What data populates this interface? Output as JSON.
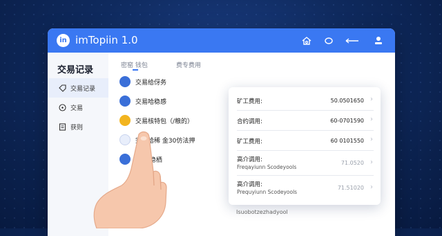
{
  "app": {
    "logo_text": "in",
    "title": "imTopiin 1.0"
  },
  "titlebar_icons": [
    "home-icon",
    "chat-icon",
    "arrow-icon",
    "user-icon"
  ],
  "sidebar": {
    "heading": "交易记录",
    "items": [
      {
        "label": "交易记录",
        "icon": "tag-icon",
        "active": true
      },
      {
        "label": "交易",
        "icon": "circle-icon",
        "active": false
      },
      {
        "label": "获则",
        "icon": "document-icon",
        "active": false
      }
    ]
  },
  "tabs": [
    {
      "label": "密窑 钱包"
    },
    {
      "label": "费专费用"
    }
  ],
  "list": [
    {
      "text": "交易给伢务",
      "icon_color": "#3a6fd8"
    },
    {
      "text": "交易哈稳感",
      "icon_color": "#3a6fd8"
    },
    {
      "text": "交易核特包（/粮的）",
      "icon_color": "#f2b41f"
    },
    {
      "text": "完易哈稀    金30仿法押",
      "icon_color": "#e8eefb"
    },
    {
      "text": "商易          稳栖",
      "icon_color": "#3a6fd8"
    }
  ],
  "card": {
    "rows": [
      {
        "label": "矿工费用:",
        "value": "50.0501650"
      },
      {
        "label": "合约调用:",
        "value": "60-0701590"
      },
      {
        "label": "矿工费用:",
        "value": "60 0101550"
      },
      {
        "label": "高介调用:",
        "sub": "Freqayiunn Scodeyools",
        "value": "71.0520"
      },
      {
        "label": "高介调用:",
        "sub": "Prequyiunn Scodeyools",
        "value": "71.51020"
      }
    ]
  },
  "footer": "Isuobotzezhadyool",
  "colors": {
    "accent": "#3a78f2",
    "gold": "#f2b41f",
    "background": "#0f2a5e"
  }
}
